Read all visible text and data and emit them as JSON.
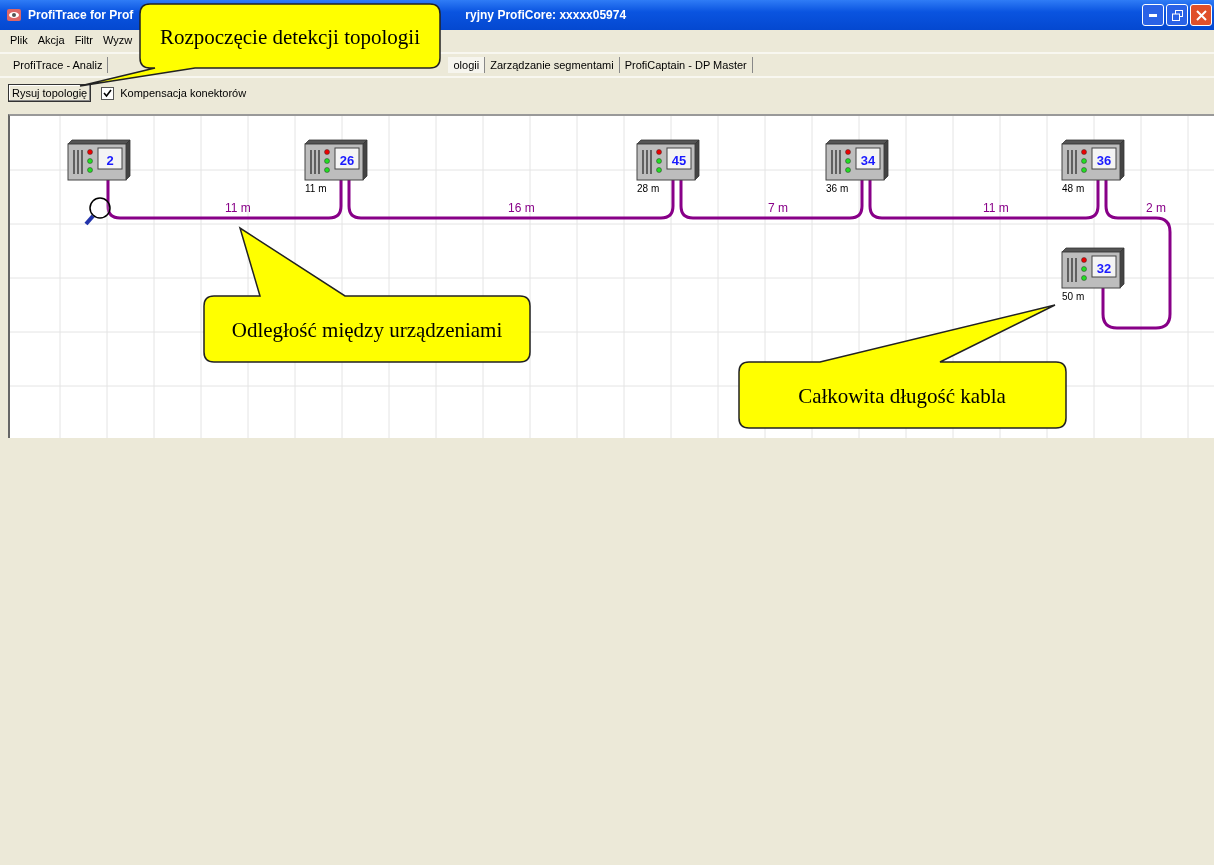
{
  "window": {
    "title_fragments": [
      "ProfiTrace for Prof",
      "ryjny ProfiCore: xxxxx05974"
    ]
  },
  "menu": [
    "Plik",
    "Akcja",
    "Filtr",
    "Wyzw"
  ],
  "tabs": [
    {
      "label": "ProfiTrace - Analiz",
      "selected": false
    },
    {
      "label": "ologii",
      "selected": true
    },
    {
      "label": "Zarządzanie segmentami",
      "selected": false
    },
    {
      "label": "ProfiCaptain - DP Master",
      "selected": false
    }
  ],
  "toolbar": {
    "button": "Rysuj topologię",
    "checkbox": {
      "label": "Kompensacja konektorów",
      "checked": true
    }
  },
  "topology": {
    "devices": [
      {
        "address": "2"
      },
      {
        "address": "26",
        "distance": "11 m"
      },
      {
        "address": "45",
        "distance": "28 m"
      },
      {
        "address": "34",
        "distance": "36 m"
      },
      {
        "address": "36",
        "distance": "48 m"
      },
      {
        "address": "32",
        "distance": "50 m"
      }
    ],
    "segments": [
      "11 m",
      "16 m",
      "7 m",
      "11 m",
      "2 m"
    ]
  },
  "callouts": [
    "Rozpoczęcie detekcji topologii",
    "Odległość między urządzeniami",
    "Całkowita długość kabla"
  ]
}
